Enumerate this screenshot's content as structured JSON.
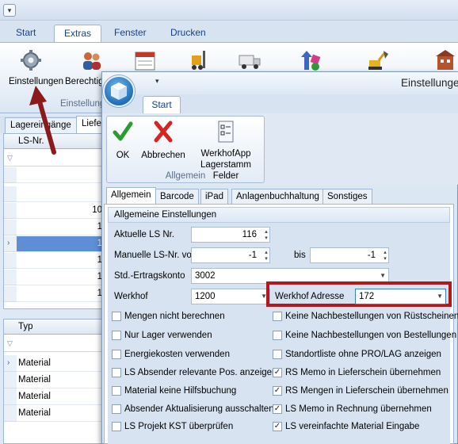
{
  "app": {
    "tabs": [
      "Start",
      "Extras",
      "Fenster",
      "Drucken"
    ],
    "ribbon_labels": [
      "Einstellungen",
      "Berechtig"
    ],
    "group_label": "Einstellung",
    "subtabs": [
      "Lagereingänge",
      "Liefe"
    ],
    "grid1": {
      "header": "LS-Nr.",
      "rows": [
        "1",
        "10",
        "1",
        "1",
        "1",
        "1"
      ]
    },
    "grid2": {
      "header": "Typ",
      "rows": [
        "Material",
        "Material",
        "Material",
        "Material"
      ]
    }
  },
  "dialog": {
    "title": "Einstellunge",
    "tab": "Start",
    "buttons": {
      "ok": "OK",
      "cancel": "Abbrechen",
      "fields_1": "WerkhofApp",
      "fields_2": "Lagerstamm Felder"
    },
    "group_label": "Allgemein",
    "inner_tabs": [
      "Allgemein",
      "Barcode",
      "iPad",
      "Anlagenbuchhaltung",
      "Sonstiges"
    ],
    "section_title": "Allgemeine Einstellungen",
    "fields": {
      "ls_nr_label": "Aktuelle LS Nr.",
      "ls_nr_value": "116",
      "manual_label": "Manuelle LS-Nr. von",
      "manual_from": "-1",
      "manual_to_label": "bis",
      "manual_to": "-1",
      "konto_label": "Std.-Ertragskonto",
      "konto_value": "3002",
      "werkhof_label": "Werkhof",
      "werkhof_value": "1200",
      "adresse_label": "Werkhof Adresse",
      "adresse_value": "172"
    },
    "checks_left": [
      {
        "label": "Mengen nicht berechnen",
        "checked": false
      },
      {
        "label": "Nur Lager verwenden",
        "checked": false
      },
      {
        "label": "Energiekosten verwenden",
        "checked": false
      },
      {
        "label": "LS Absender relevante Pos. anzeigen",
        "checked": false
      },
      {
        "label": "Material keine Hilfsbuchung",
        "checked": false
      },
      {
        "label": "Absender Aktualisierung ausschalten",
        "checked": false
      },
      {
        "label": "LS Projekt KST überprüfen",
        "checked": false
      }
    ],
    "checks_right": [
      {
        "label": "Keine Nachbestellungen von Rüstscheinen",
        "checked": false
      },
      {
        "label": "Keine Nachbestellungen von Bestellungen",
        "checked": false
      },
      {
        "label": "Standortliste ohne PRO/LAG anzeigen",
        "checked": false
      },
      {
        "label": "RS Memo in Lieferschein übernehmen",
        "checked": true
      },
      {
        "label": "RS Mengen in Lieferschein übernehmen",
        "checked": true
      },
      {
        "label": "LS Memo in Rechnung übernehmen",
        "checked": true
      },
      {
        "label": "LS vereinfachte Material Eingabe",
        "checked": true
      }
    ],
    "highlight_color": "#b3181c",
    "arrow_color": "#8b1a1c"
  }
}
